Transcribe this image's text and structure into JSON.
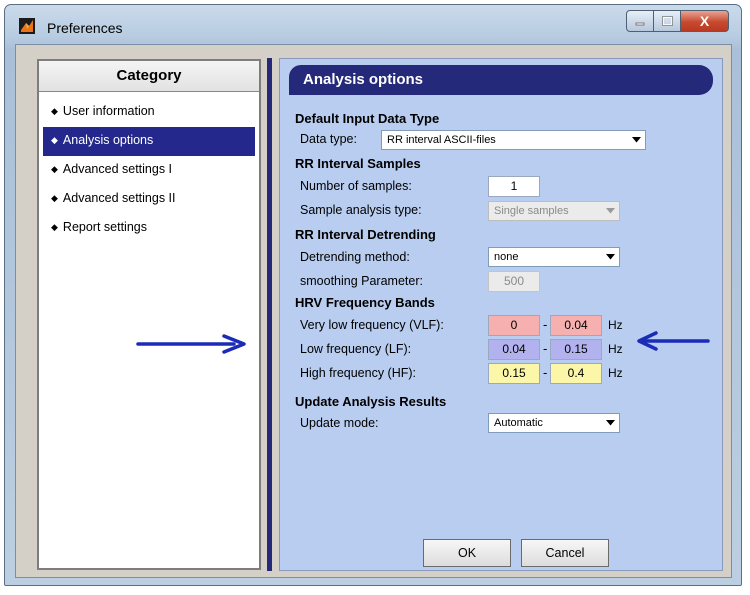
{
  "window": {
    "title": "Preferences",
    "icon": "matlab-logo-icon",
    "controls": [
      "minimize-icon",
      "maximize-icon",
      "close-icon"
    ],
    "close_glyph": "X"
  },
  "category": {
    "header": "Category",
    "items": [
      {
        "label": "User information",
        "selected": false
      },
      {
        "label": "Analysis options",
        "selected": true
      },
      {
        "label": "Advanced settings I",
        "selected": false
      },
      {
        "label": "Advanced settings II",
        "selected": false
      },
      {
        "label": "Report settings",
        "selected": false
      }
    ],
    "bullet": "◆"
  },
  "panel": {
    "title": "Analysis options",
    "input_type": {
      "heading": "Default Input Data Type",
      "label": "Data type:",
      "value": "RR interval ASCII-files"
    },
    "samples": {
      "heading": "RR Interval Samples",
      "count_label": "Number of samples:",
      "count_value": "1",
      "type_label": "Sample analysis type:",
      "type_value": "Single samples"
    },
    "detrending": {
      "heading": "RR Interval Detrending",
      "method_label": "Detrending method:",
      "method_value": "none",
      "param_label": "smoothing Parameter:",
      "param_value": "500"
    },
    "bands": {
      "heading": "HRV Frequency Bands",
      "dash": "-",
      "unit": "Hz",
      "vlf": {
        "label": "Very low frequency (VLF):",
        "from": "0",
        "to": "0.04"
      },
      "lf": {
        "label": "Low frequency (LF):",
        "from": "0.04",
        "to": "0.15"
      },
      "hf": {
        "label": "High frequency (HF):",
        "from": "0.15",
        "to": "0.4"
      }
    },
    "update": {
      "heading": "Update Analysis Results",
      "mode_label": "Update mode:",
      "mode_value": "Automatic"
    },
    "buttons": {
      "ok": "OK",
      "cancel": "Cancel"
    }
  },
  "colors": {
    "accent": "#25297a",
    "panel_bg": "#b8cdf0",
    "vlf": "#f7b0b0",
    "lf": "#b2b2ee",
    "hf": "#fbf6a8",
    "annotation_arrow": "#1a2bb8"
  }
}
